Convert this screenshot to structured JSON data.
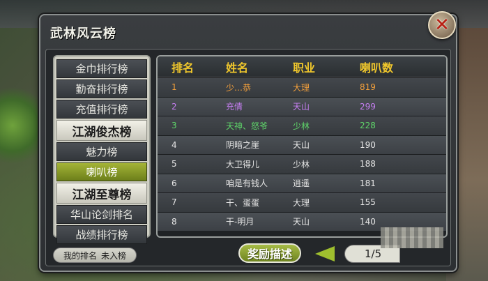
{
  "window": {
    "title": "武林风云榜"
  },
  "menu": {
    "items": [
      {
        "label": "金巾排行榜",
        "style": "normal"
      },
      {
        "label": "勤奋排行榜",
        "style": "normal"
      },
      {
        "label": "充值排行榜",
        "style": "normal"
      },
      {
        "label": "江湖俊杰榜",
        "style": "big"
      },
      {
        "label": "魅力榜",
        "style": "normal"
      },
      {
        "label": "喇叭榜",
        "style": "active"
      },
      {
        "label": "江湖至尊榜",
        "style": "big"
      },
      {
        "label": "华山论剑排名",
        "style": "normal"
      },
      {
        "label": "战绩排行榜",
        "style": "normal"
      }
    ]
  },
  "table": {
    "headers": [
      "排名",
      "姓名",
      "职业",
      "喇叭数"
    ],
    "rows": [
      [
        "1",
        "少…恭",
        "大理",
        "819"
      ],
      [
        "2",
        "充倩",
        "天山",
        "299"
      ],
      [
        "3",
        "天神、怒爷",
        "少林",
        "228"
      ],
      [
        "4",
        "阴暗之崖",
        "天山",
        "190"
      ],
      [
        "5",
        "大卫得儿",
        "少林",
        "188"
      ],
      [
        "6",
        "咱是有钱人",
        "逍遥",
        "181"
      ],
      [
        "7",
        "干、蛋蛋",
        "大理",
        "155"
      ],
      [
        "8",
        "干-明月",
        "天山",
        "140"
      ]
    ],
    "rank_colors": {
      "1": "#f29f3b",
      "2": "#c67ff2",
      "3": "#5fd66a"
    }
  },
  "footer": {
    "my_rank_label": "我的排名",
    "my_rank_value": "未入榜",
    "reward_button": "奖励描述",
    "page_indicator": "1/5"
  },
  "colors": {
    "header_text": "#f0c72c",
    "active_tab": "#8fa32a",
    "close_x": "#b81e12"
  },
  "icons": {
    "close": "close-icon",
    "prev_page": "left-arrow-icon"
  }
}
